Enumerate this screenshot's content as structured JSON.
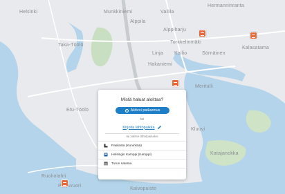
{
  "map": {
    "labels": {
      "helsinki": "Helsinki",
      "munkkiniemi": "Munkkiniemi",
      "vallila": "Vallila",
      "hermanninranta": "Hermanninranta",
      "alppila": "Alppila",
      "alppiharju": "Alppiharju",
      "taka_toolo": "Taka-Töölö",
      "torkkelinmaki": "Torkkelinmäki",
      "kalasatama": "Kalasatama",
      "linja": "Linja",
      "kallio": "Kallio",
      "sornainen": "Sörnäinen",
      "hakaniemi": "Hakaniemi",
      "meritulli": "Meritulli",
      "etu_toolo": "Etu-Töölö",
      "kluuvi": "Kluuvi",
      "katajanokka": "Katajanokka",
      "ruoholahti": "Ruoholahti",
      "punavuori": "Punavuori",
      "kaivopuisto": "Kaivopuisto"
    }
  },
  "dialog": {
    "title": "Mistä haluat aloittaa?",
    "locate_label": "Aktivoi paikannus",
    "or_label": "tai",
    "origin_label": "Kirjoita lähtöpaikka",
    "or_choose_label": "tai valitse lähtöpaikaksi",
    "places": [
      {
        "label": "Pasilasta (Kuninkää)",
        "icon": "train-station-icon"
      },
      {
        "label": "Helsingin Kamppi (Kamppi)",
        "icon": "bus-station-icon"
      },
      {
        "label": "Turun satama",
        "icon": "ferry-terminal-icon"
      }
    ]
  }
}
